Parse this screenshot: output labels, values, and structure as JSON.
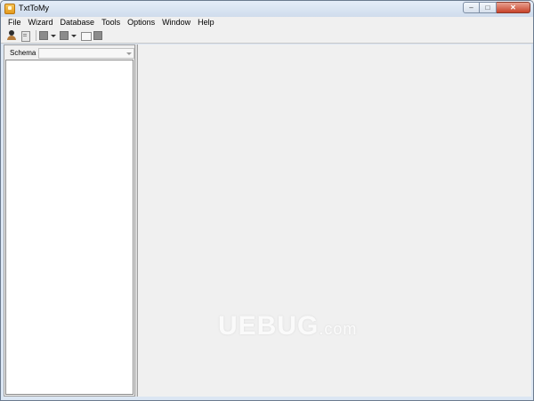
{
  "window": {
    "title": "TxtToMy",
    "controls": {
      "minimize": "–",
      "maximize": "□",
      "close": "✕"
    }
  },
  "menubar": {
    "items": [
      "File",
      "Wizard",
      "Database",
      "Tools",
      "Options",
      "Window",
      "Help"
    ]
  },
  "toolbar": {
    "icons": [
      "user-icon",
      "document-icon",
      "gray-square-icon",
      "gray-square-icon",
      "frame-icon",
      "gray-square-icon"
    ]
  },
  "left_panel": {
    "schema_label": "Schema",
    "schema_value": ""
  },
  "watermark": {
    "brand": "UEBUG",
    "suffix": ".com"
  }
}
